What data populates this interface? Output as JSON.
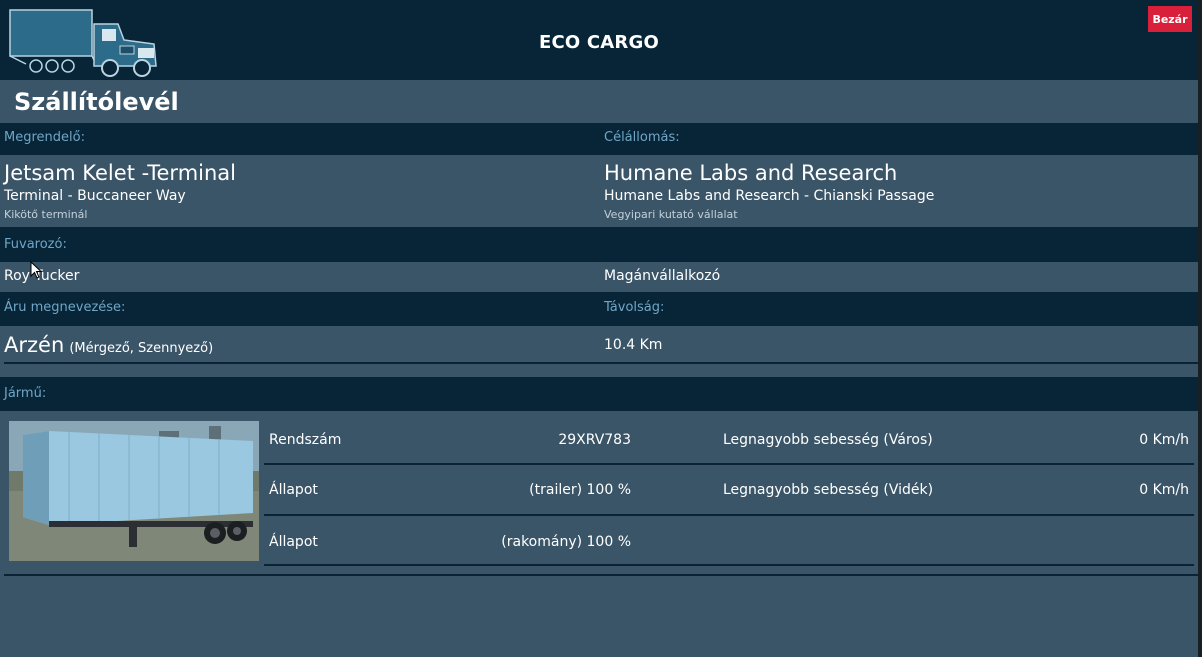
{
  "header": {
    "title": "ECO CARGO",
    "close_label": "Bezár"
  },
  "document": {
    "title": "Szállítólevél"
  },
  "sender": {
    "label": "Megrendelő:",
    "name": "Jetsam Kelet -Terminal",
    "address": "Terminal - Buccaneer Way",
    "type": "Kikötő terminál"
  },
  "destination": {
    "label": "Célállomás:",
    "name": "Humane Labs and Research",
    "address": "Humane Labs and Research - Chianski Passage",
    "type": "Vegyipari kutató vállalat"
  },
  "carrier": {
    "label": "Fuvarozó:",
    "name": "Roy Tucker",
    "type": "Magánvállalkozó"
  },
  "cargo": {
    "label": "Áru megnevezése:",
    "name": "Arzén",
    "tags": "(Mérgező, Szennyező)",
    "distance_label": "Távolság:",
    "distance": "10.4 Km"
  },
  "vehicle": {
    "label": "Jármű:",
    "rows": [
      {
        "label": "Rendszám",
        "value": "29XRV783",
        "label2": "Legnagyobb sebesség (Város)",
        "value2": "0 Km/h"
      },
      {
        "label": "Állapot",
        "value": "(trailer) 100 %",
        "label2": "Legnagyobb sebesség (Vidék)",
        "value2": "0 Km/h"
      },
      {
        "label": "Állapot",
        "value": "(rakomány) 100 %"
      }
    ]
  }
}
